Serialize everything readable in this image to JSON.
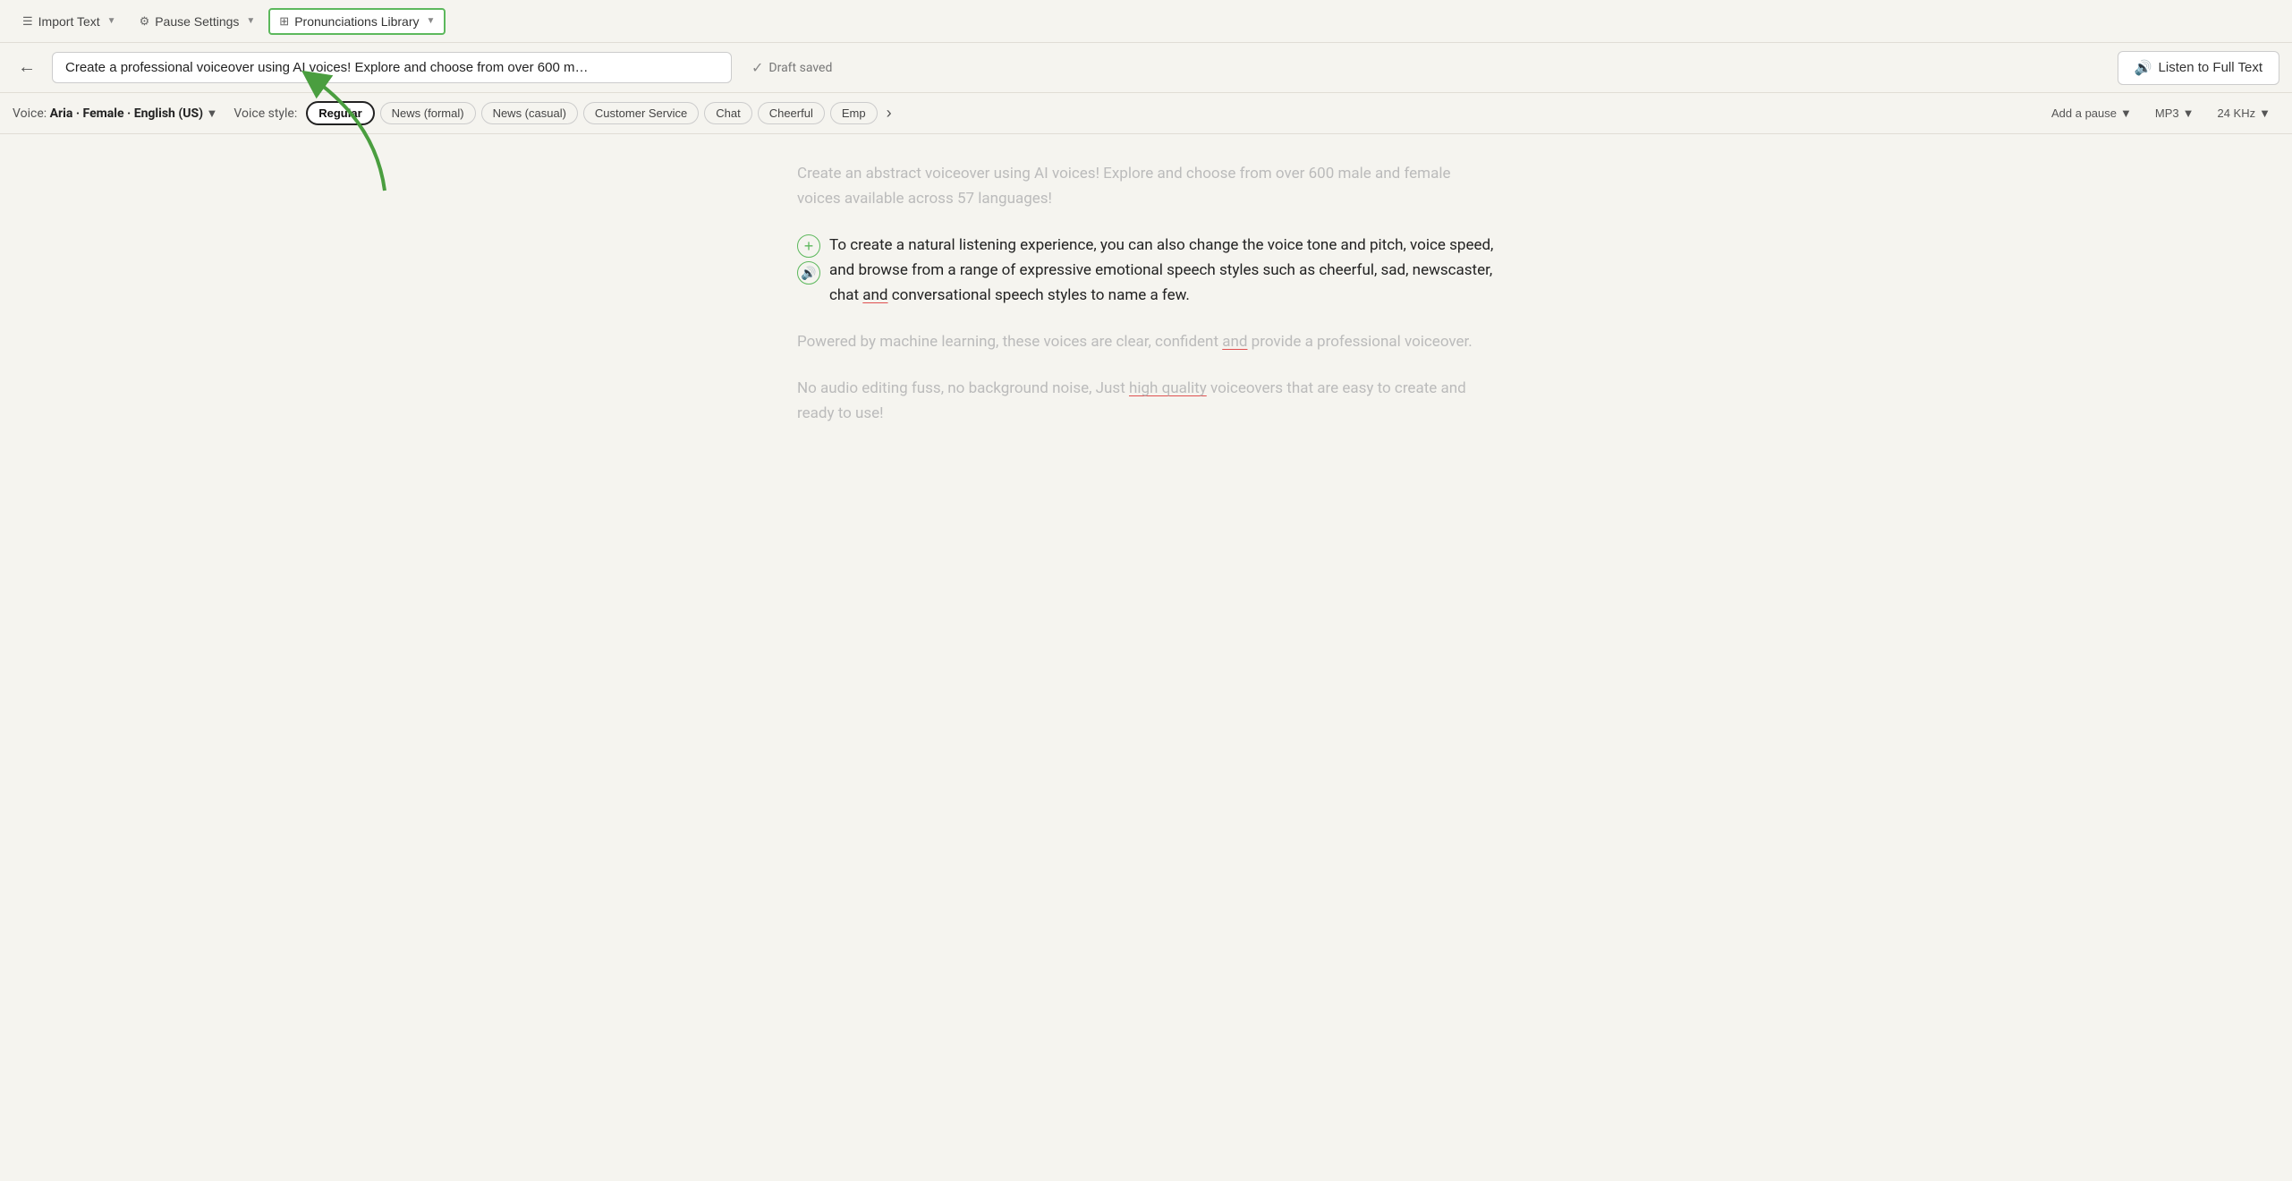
{
  "toolbar": {
    "import_label": "Import Text",
    "pause_settings_label": "Pause Settings",
    "pronunciations_label": "Pronunciations Library"
  },
  "searchbar": {
    "back_label": "←",
    "input_value": "Create a professional voiceover using AI voices! Explore and choose from over 600 m…",
    "draft_saved": "Draft saved",
    "listen_label": "Listen to Full Text"
  },
  "voice": {
    "label": "Voice:",
    "name": "Aria · Female · English (US)",
    "style_label": "Voice style:"
  },
  "styles": [
    {
      "id": "regular",
      "label": "Regular",
      "selected": true
    },
    {
      "id": "news-formal",
      "label": "News (formal)",
      "selected": false
    },
    {
      "id": "news-casual",
      "label": "News (casual)",
      "selected": false
    },
    {
      "id": "customer-service",
      "label": "Customer Service",
      "selected": false
    },
    {
      "id": "chat",
      "label": "Chat",
      "selected": false
    },
    {
      "id": "cheerful",
      "label": "Cheerful",
      "selected": false
    },
    {
      "id": "emp",
      "label": "Emp",
      "selected": false
    }
  ],
  "controls": {
    "add_pause": "Add a pause",
    "format": "MP3",
    "khz": "24 KHz"
  },
  "content": {
    "paragraph1": "Create an abstract voiceover using AI voices! Explore and choose from over 600 male and female voices available across 57 languages!",
    "paragraph2_parts": [
      {
        "text": "To create a natural listening experience, you can also change the voice tone and pitch, voice speed, and browse from a range of expressive emotional speech styles such as cheerful, sad, newscaster, chat ",
        "plain": true
      },
      {
        "text": "and",
        "underline": true
      },
      {
        "text": " conversational speech styles to name a few.",
        "plain": true
      }
    ],
    "paragraph3_parts": [
      {
        "text": "Powered by machine learning, these voices are clear, confident ",
        "plain": true
      },
      {
        "text": "and",
        "underline": true
      },
      {
        "text": " provide a professional voiceover.",
        "plain": true
      }
    ],
    "paragraph4_parts": [
      {
        "text": "No audio editing fuss, no background noise, Just ",
        "plain": true
      },
      {
        "text": "high quality",
        "underline": true
      },
      {
        "text": " voiceovers that are easy to create and ready to use!",
        "plain": true
      }
    ]
  }
}
